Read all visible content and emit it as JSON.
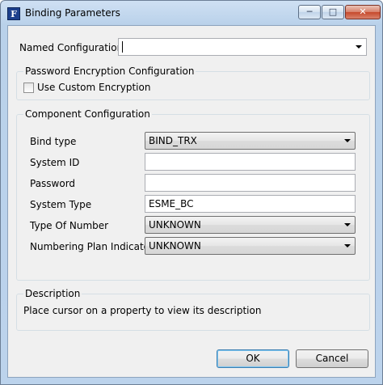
{
  "window": {
    "title": "Binding Parameters",
    "icon_letter": "F"
  },
  "named_configuration": {
    "label": "Named Configuration",
    "value": ""
  },
  "password_encryption": {
    "title": "Password Encryption Configuration",
    "use_custom_label": "Use Custom Encryption",
    "use_custom_checked": false
  },
  "component": {
    "title": "Component Configuration",
    "bind_type": {
      "label": "Bind type",
      "value": "BIND_TRX"
    },
    "system_id": {
      "label": "System ID",
      "value": ""
    },
    "password": {
      "label": "Password",
      "value": ""
    },
    "system_type": {
      "label": "System Type",
      "value": "ESME_BC"
    },
    "type_of_number": {
      "label": "Type Of Number",
      "value": "UNKNOWN"
    },
    "numbering_plan": {
      "label": "Numbering Plan Indicator",
      "value": "UNKNOWN"
    }
  },
  "description": {
    "title": "Description",
    "text": "Place cursor on a property to view its description"
  },
  "buttons": {
    "ok": "OK",
    "cancel": "Cancel"
  }
}
